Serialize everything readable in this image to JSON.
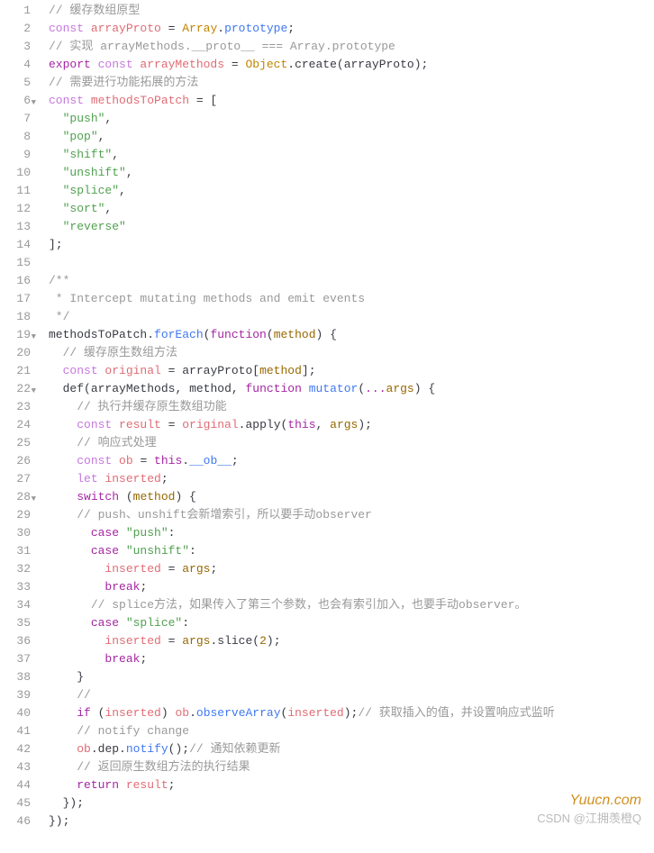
{
  "totalLines": 46,
  "foldLines": [
    6,
    19,
    22,
    28
  ],
  "tokens": {
    "1": [
      {
        "t": "// 缓存数组原型",
        "c": "c-comment"
      }
    ],
    "2": [
      {
        "t": "const ",
        "c": "c-keyword"
      },
      {
        "t": "arrayProto",
        "c": "c-var"
      },
      {
        "t": " = ",
        "c": "c-punct"
      },
      {
        "t": "Array",
        "c": "c-builtin"
      },
      {
        "t": ".",
        "c": "c-punct"
      },
      {
        "t": "prototype",
        "c": "c-prop"
      },
      {
        "t": ";",
        "c": "c-punct"
      }
    ],
    "3": [
      {
        "t": "// 实现 arrayMethods.__proto__ === Array.prototype",
        "c": "c-comment"
      }
    ],
    "4": [
      {
        "t": "export ",
        "c": "c-keyword2"
      },
      {
        "t": "const ",
        "c": "c-keyword"
      },
      {
        "t": "arrayMethods",
        "c": "c-var"
      },
      {
        "t": " = ",
        "c": "c-punct"
      },
      {
        "t": "Object",
        "c": "c-builtin"
      },
      {
        "t": ".",
        "c": "c-punct"
      },
      {
        "t": "create",
        "c": "c-text"
      },
      {
        "t": "(",
        "c": "c-punct"
      },
      {
        "t": "arrayProto",
        "c": "c-text"
      },
      {
        "t": ");",
        "c": "c-punct"
      }
    ],
    "5": [
      {
        "t": "// 需要进行功能拓展的方法",
        "c": "c-comment"
      }
    ],
    "6": [
      {
        "t": "const ",
        "c": "c-keyword"
      },
      {
        "t": "methodsToPatch",
        "c": "c-var"
      },
      {
        "t": " = [",
        "c": "c-punct"
      }
    ],
    "7": [
      {
        "t": "  ",
        "c": ""
      },
      {
        "t": "\"push\"",
        "c": "c-string"
      },
      {
        "t": ",",
        "c": "c-punct"
      }
    ],
    "8": [
      {
        "t": "  ",
        "c": ""
      },
      {
        "t": "\"pop\"",
        "c": "c-string"
      },
      {
        "t": ",",
        "c": "c-punct"
      }
    ],
    "9": [
      {
        "t": "  ",
        "c": ""
      },
      {
        "t": "\"shift\"",
        "c": "c-string"
      },
      {
        "t": ",",
        "c": "c-punct"
      }
    ],
    "10": [
      {
        "t": "  ",
        "c": ""
      },
      {
        "t": "\"unshift\"",
        "c": "c-string"
      },
      {
        "t": ",",
        "c": "c-punct"
      }
    ],
    "11": [
      {
        "t": "  ",
        "c": ""
      },
      {
        "t": "\"splice\"",
        "c": "c-string"
      },
      {
        "t": ",",
        "c": "c-punct"
      }
    ],
    "12": [
      {
        "t": "  ",
        "c": ""
      },
      {
        "t": "\"sort\"",
        "c": "c-string"
      },
      {
        "t": ",",
        "c": "c-punct"
      }
    ],
    "13": [
      {
        "t": "  ",
        "c": ""
      },
      {
        "t": "\"reverse\"",
        "c": "c-string"
      }
    ],
    "14": [
      {
        "t": "];",
        "c": "c-punct"
      }
    ],
    "15": [
      {
        "t": "",
        "c": ""
      }
    ],
    "16": [
      {
        "t": "/**",
        "c": "c-comment"
      }
    ],
    "17": [
      {
        "t": " * Intercept mutating methods and emit events",
        "c": "c-comment"
      }
    ],
    "18": [
      {
        "t": " */",
        "c": "c-comment"
      }
    ],
    "19": [
      {
        "t": "methodsToPatch",
        "c": "c-text"
      },
      {
        "t": ".",
        "c": "c-punct"
      },
      {
        "t": "forEach",
        "c": "c-prop"
      },
      {
        "t": "(",
        "c": "c-punct"
      },
      {
        "t": "function",
        "c": "c-keyword2"
      },
      {
        "t": "(",
        "c": "c-punct"
      },
      {
        "t": "method",
        "c": "c-param"
      },
      {
        "t": ") {",
        "c": "c-punct"
      }
    ],
    "20": [
      {
        "t": "  ",
        "c": ""
      },
      {
        "t": "// 缓存原生数组方法",
        "c": "c-comment"
      }
    ],
    "21": [
      {
        "t": "  ",
        "c": ""
      },
      {
        "t": "const ",
        "c": "c-keyword"
      },
      {
        "t": "original",
        "c": "c-var"
      },
      {
        "t": " = ",
        "c": "c-punct"
      },
      {
        "t": "arrayProto",
        "c": "c-text"
      },
      {
        "t": "[",
        "c": "c-punct"
      },
      {
        "t": "method",
        "c": "c-param"
      },
      {
        "t": "];",
        "c": "c-punct"
      }
    ],
    "22": [
      {
        "t": "  ",
        "c": ""
      },
      {
        "t": "def",
        "c": "c-text"
      },
      {
        "t": "(",
        "c": "c-punct"
      },
      {
        "t": "arrayMethods",
        "c": "c-text"
      },
      {
        "t": ", ",
        "c": "c-punct"
      },
      {
        "t": "method",
        "c": "c-text"
      },
      {
        "t": ", ",
        "c": "c-punct"
      },
      {
        "t": "function ",
        "c": "c-keyword2"
      },
      {
        "t": "mutator",
        "c": "c-prop"
      },
      {
        "t": "(",
        "c": "c-punct"
      },
      {
        "t": "...",
        "c": "c-keyword2"
      },
      {
        "t": "args",
        "c": "c-param"
      },
      {
        "t": ") {",
        "c": "c-punct"
      }
    ],
    "23": [
      {
        "t": "    ",
        "c": ""
      },
      {
        "t": "// 执行并缓存原生数组功能",
        "c": "c-comment"
      }
    ],
    "24": [
      {
        "t": "    ",
        "c": ""
      },
      {
        "t": "const ",
        "c": "c-keyword"
      },
      {
        "t": "result",
        "c": "c-var"
      },
      {
        "t": " = ",
        "c": "c-punct"
      },
      {
        "t": "original",
        "c": "c-var"
      },
      {
        "t": ".",
        "c": "c-punct"
      },
      {
        "t": "apply",
        "c": "c-text"
      },
      {
        "t": "(",
        "c": "c-punct"
      },
      {
        "t": "this",
        "c": "c-keyword2"
      },
      {
        "t": ", ",
        "c": "c-punct"
      },
      {
        "t": "args",
        "c": "c-param"
      },
      {
        "t": ");",
        "c": "c-punct"
      }
    ],
    "25": [
      {
        "t": "    ",
        "c": ""
      },
      {
        "t": "// 响应式处理",
        "c": "c-comment"
      }
    ],
    "26": [
      {
        "t": "    ",
        "c": ""
      },
      {
        "t": "const ",
        "c": "c-keyword"
      },
      {
        "t": "ob",
        "c": "c-var"
      },
      {
        "t": " = ",
        "c": "c-punct"
      },
      {
        "t": "this",
        "c": "c-keyword2"
      },
      {
        "t": ".",
        "c": "c-punct"
      },
      {
        "t": "__ob__",
        "c": "c-prop"
      },
      {
        "t": ";",
        "c": "c-punct"
      }
    ],
    "27": [
      {
        "t": "    ",
        "c": ""
      },
      {
        "t": "let ",
        "c": "c-keyword"
      },
      {
        "t": "inserted",
        "c": "c-var"
      },
      {
        "t": ";",
        "c": "c-punct"
      }
    ],
    "28": [
      {
        "t": "    ",
        "c": ""
      },
      {
        "t": "switch ",
        "c": "c-keyword2"
      },
      {
        "t": "(",
        "c": "c-punct"
      },
      {
        "t": "method",
        "c": "c-param"
      },
      {
        "t": ") {",
        "c": "c-punct"
      }
    ],
    "29": [
      {
        "t": "    ",
        "c": ""
      },
      {
        "t": "// push、unshift会新增索引，所以要手动observer",
        "c": "c-comment"
      }
    ],
    "30": [
      {
        "t": "      ",
        "c": ""
      },
      {
        "t": "case ",
        "c": "c-keyword2"
      },
      {
        "t": "\"push\"",
        "c": "c-string"
      },
      {
        "t": ":",
        "c": "c-punct"
      }
    ],
    "31": [
      {
        "t": "      ",
        "c": ""
      },
      {
        "t": "case ",
        "c": "c-keyword2"
      },
      {
        "t": "\"unshift\"",
        "c": "c-string"
      },
      {
        "t": ":",
        "c": "c-punct"
      }
    ],
    "32": [
      {
        "t": "        ",
        "c": ""
      },
      {
        "t": "inserted",
        "c": "c-var"
      },
      {
        "t": " = ",
        "c": "c-punct"
      },
      {
        "t": "args",
        "c": "c-param"
      },
      {
        "t": ";",
        "c": "c-punct"
      }
    ],
    "33": [
      {
        "t": "        ",
        "c": ""
      },
      {
        "t": "break",
        "c": "c-keyword2"
      },
      {
        "t": ";",
        "c": "c-punct"
      }
    ],
    "34": [
      {
        "t": "      ",
        "c": ""
      },
      {
        "t": "// splice方法，如果传入了第三个参数，也会有索引加入，也要手动observer。",
        "c": "c-comment"
      }
    ],
    "35": [
      {
        "t": "      ",
        "c": ""
      },
      {
        "t": "case ",
        "c": "c-keyword2"
      },
      {
        "t": "\"splice\"",
        "c": "c-string"
      },
      {
        "t": ":",
        "c": "c-punct"
      }
    ],
    "36": [
      {
        "t": "        ",
        "c": ""
      },
      {
        "t": "inserted",
        "c": "c-var"
      },
      {
        "t": " = ",
        "c": "c-punct"
      },
      {
        "t": "args",
        "c": "c-param"
      },
      {
        "t": ".",
        "c": "c-punct"
      },
      {
        "t": "slice",
        "c": "c-text"
      },
      {
        "t": "(",
        "c": "c-punct"
      },
      {
        "t": "2",
        "c": "c-param"
      },
      {
        "t": ");",
        "c": "c-punct"
      }
    ],
    "37": [
      {
        "t": "        ",
        "c": ""
      },
      {
        "t": "break",
        "c": "c-keyword2"
      },
      {
        "t": ";",
        "c": "c-punct"
      }
    ],
    "38": [
      {
        "t": "    }",
        "c": "c-punct"
      }
    ],
    "39": [
      {
        "t": "    ",
        "c": ""
      },
      {
        "t": "// ",
        "c": "c-comment"
      }
    ],
    "40": [
      {
        "t": "    ",
        "c": ""
      },
      {
        "t": "if ",
        "c": "c-keyword2"
      },
      {
        "t": "(",
        "c": "c-punct"
      },
      {
        "t": "inserted",
        "c": "c-var"
      },
      {
        "t": ") ",
        "c": "c-punct"
      },
      {
        "t": "ob",
        "c": "c-var"
      },
      {
        "t": ".",
        "c": "c-punct"
      },
      {
        "t": "observeArray",
        "c": "c-prop"
      },
      {
        "t": "(",
        "c": "c-punct"
      },
      {
        "t": "inserted",
        "c": "c-var"
      },
      {
        "t": ");",
        "c": "c-punct"
      },
      {
        "t": "// 获取插入的值，并设置响应式监听",
        "c": "c-comment"
      }
    ],
    "41": [
      {
        "t": "    ",
        "c": ""
      },
      {
        "t": "// notify change",
        "c": "c-comment"
      }
    ],
    "42": [
      {
        "t": "    ",
        "c": ""
      },
      {
        "t": "ob",
        "c": "c-var"
      },
      {
        "t": ".",
        "c": "c-punct"
      },
      {
        "t": "dep",
        "c": "c-text"
      },
      {
        "t": ".",
        "c": "c-punct"
      },
      {
        "t": "notify",
        "c": "c-prop"
      },
      {
        "t": "();",
        "c": "c-punct"
      },
      {
        "t": "// 通知依赖更新",
        "c": "c-comment"
      }
    ],
    "43": [
      {
        "t": "    ",
        "c": ""
      },
      {
        "t": "// 返回原生数组方法的执行结果",
        "c": "c-comment"
      }
    ],
    "44": [
      {
        "t": "    ",
        "c": ""
      },
      {
        "t": "return ",
        "c": "c-keyword2"
      },
      {
        "t": "result",
        "c": "c-var"
      },
      {
        "t": ";",
        "c": "c-punct"
      }
    ],
    "45": [
      {
        "t": "  });",
        "c": "c-punct"
      }
    ],
    "46": [
      {
        "t": "});",
        "c": "c-punct"
      }
    ]
  },
  "watermark": "Yuucn.com",
  "author": "CSDN @江拥羡橙Q"
}
